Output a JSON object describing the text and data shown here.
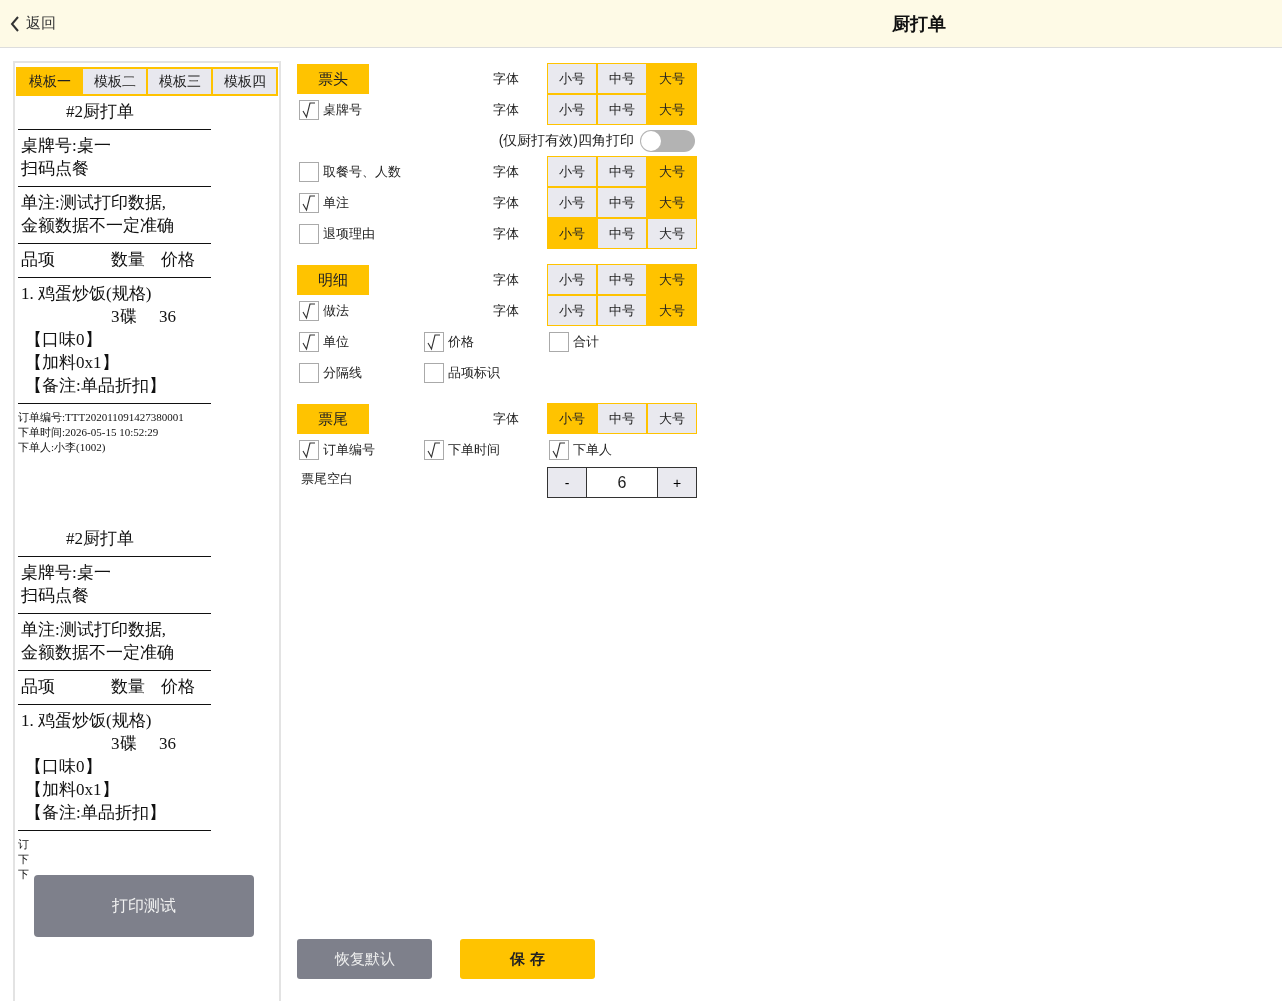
{
  "header": {
    "back": "返回",
    "title": "厨打单"
  },
  "template_tabs": [
    {
      "label": "模板一",
      "selected": true
    },
    {
      "label": "模板二",
      "selected": false
    },
    {
      "label": "模板三",
      "selected": false
    },
    {
      "label": "模板四",
      "selected": false
    }
  ],
  "receipts": [
    {
      "title": "#2厨打单",
      "table_lines": [
        "桌牌号:桌一",
        "扫码点餐"
      ],
      "note_lines": [
        "单注:测试打印数据,",
        "金额数据不一定准确"
      ],
      "columns": [
        "品项",
        "数量",
        "价格"
      ],
      "item": "1. 鸡蛋炒饭(规格)",
      "quantity": "3碟",
      "price": "36",
      "extras": [
        "【口味0】",
        "【加料0x1】",
        "【备注:单品折扣】"
      ],
      "footer": [
        "订单编号:TTT202011091427380001",
        "下单时间:2026-05-15 10:52:29",
        "下单人:小李(1002)"
      ]
    },
    {
      "title": "#2厨打单",
      "table_lines": [
        "桌牌号:桌一",
        "扫码点餐"
      ],
      "note_lines": [
        "单注:测试打印数据,",
        "金额数据不一定准确"
      ],
      "columns": [
        "品项",
        "数量",
        "价格"
      ],
      "item": "1. 鸡蛋炒饭(规格)",
      "quantity": "3碟",
      "price": "36",
      "extras": [
        "【口味0】",
        "【加料0x1】",
        "【备注:单品折扣】"
      ],
      "footer": [
        "订",
        "下",
        "下"
      ]
    }
  ],
  "print_test_button": "打印测试",
  "sections": [
    {
      "title": "票头",
      "font_label": "字体",
      "sizes": [
        {
          "label": "小号",
          "selected": false
        },
        {
          "label": "中号",
          "selected": false
        },
        {
          "label": "大号",
          "selected": true
        }
      ],
      "rows": [
        {
          "kind": "check",
          "label": "桌牌号",
          "checked": true,
          "font_label": "字体",
          "sizes": [
            {
              "label": "小号",
              "selected": false
            },
            {
              "label": "中号",
              "selected": false
            },
            {
              "label": "大号",
              "selected": true
            }
          ]
        },
        {
          "kind": "toggle",
          "label": "(仅厨打有效)四角打印",
          "on": false
        },
        {
          "kind": "check",
          "label": "取餐号、人数",
          "checked": false,
          "font_label": "字体",
          "sizes": [
            {
              "label": "小号",
              "selected": false
            },
            {
              "label": "中号",
              "selected": false
            },
            {
              "label": "大号",
              "selected": true
            }
          ]
        },
        {
          "kind": "check",
          "label": "单注",
          "checked": true,
          "font_label": "字体",
          "sizes": [
            {
              "label": "小号",
              "selected": false
            },
            {
              "label": "中号",
              "selected": false
            },
            {
              "label": "大号",
              "selected": true
            }
          ]
        },
        {
          "kind": "check",
          "label": "退项理由",
          "checked": false,
          "font_label": "字体",
          "sizes": [
            {
              "label": "小号",
              "selected": true
            },
            {
              "label": "中号",
              "selected": false
            },
            {
              "label": "大号",
              "selected": false
            }
          ]
        }
      ]
    },
    {
      "title": "明细",
      "font_label": "字体",
      "sizes": [
        {
          "label": "小号",
          "selected": false
        },
        {
          "label": "中号",
          "selected": false
        },
        {
          "label": "大号",
          "selected": true
        }
      ],
      "rows": [
        {
          "kind": "check",
          "label": "做法",
          "checked": true,
          "font_label": "字体",
          "sizes": [
            {
              "label": "小号",
              "selected": false
            },
            {
              "label": "中号",
              "selected": false
            },
            {
              "label": "大号",
              "selected": true
            }
          ]
        },
        {
          "kind": "checks",
          "items": [
            {
              "label": "单位",
              "checked": true
            },
            {
              "label": "价格",
              "checked": true
            },
            {
              "label": "合计",
              "checked": false
            }
          ]
        },
        {
          "kind": "checks",
          "items": [
            {
              "label": "分隔线",
              "checked": false
            },
            {
              "label": "品项标识",
              "checked": false
            }
          ]
        }
      ]
    },
    {
      "title": "票尾",
      "font_label": "字体",
      "sizes": [
        {
          "label": "小号",
          "selected": true
        },
        {
          "label": "中号",
          "selected": false
        },
        {
          "label": "大号",
          "selected": false
        }
      ],
      "rows": [
        {
          "kind": "checks",
          "items": [
            {
              "label": "订单编号",
              "checked": true
            },
            {
              "label": "下单时间",
              "checked": true
            },
            {
              "label": "下单人",
              "checked": true
            }
          ]
        },
        {
          "kind": "stepper",
          "label": "票尾空白",
          "minus": "-",
          "value": "6",
          "plus": "+"
        }
      ]
    }
  ],
  "buttons": [
    {
      "label": "恢复默认",
      "kind": "secondary"
    },
    {
      "label": "保 存",
      "kind": "primary"
    }
  ]
}
